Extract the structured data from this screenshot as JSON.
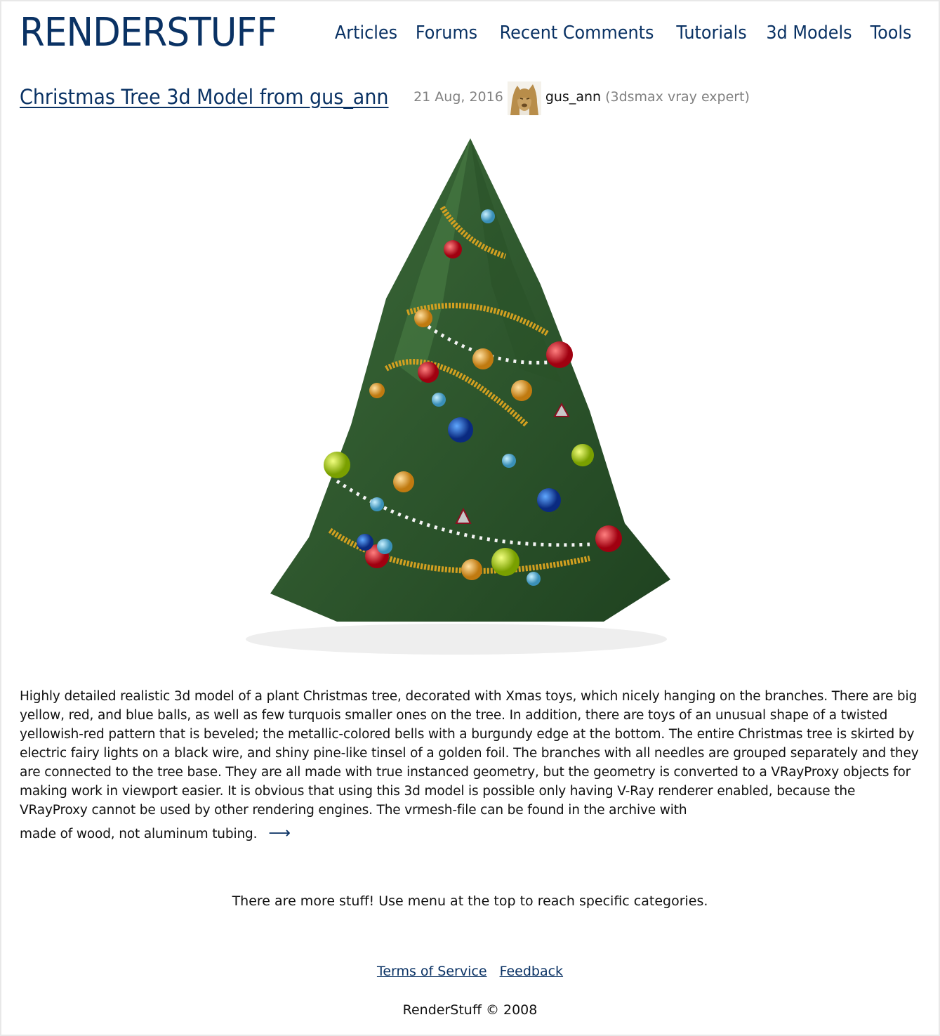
{
  "site": {
    "logo": "RENDERSTUFF",
    "nav": [
      "Articles",
      "Forums",
      "Recent Comments",
      "Tutorials",
      "3d Models",
      "Tools"
    ]
  },
  "post": {
    "title": "Christmas Tree 3d Model from gus_ann",
    "date": "21 Aug, 2016",
    "author": "gus_ann",
    "author_role": "(3dsmax vray expert)",
    "avatar_icon": "cougar-avatar",
    "image_alt": "Decorated Christmas tree 3d render",
    "description": "Highly detailed realistic 3d model of a plant Christmas tree, decorated with Xmas toys, which nicely hanging on the branches. There are big yellow, red, and blue balls, as well as few turquois smaller ones on the tree. In addition, there are toys of an unusual shape of a twisted yellowish-red pattern that is beveled; the metallic-colored bells with a burgundy edge at the bottom. The entire Christmas tree is skirted by electric fairy lights on a black wire, and shiny pine-like tinsel of a golden foil. The branches with all needles are grouped separately and they are connected to the tree base. They are all made with true instanced geometry, but the geometry is converted to a VRayProxy objects for making work in viewport easier. It is obvious that using this 3d model is possible only having V-Ray renderer enabled, because the VRayProxy cannot be used by other rendering engines. The vrmesh-file can be found in the archive with",
    "description_tail": "made of wood, not aluminum tubing.",
    "read_more": "⟶"
  },
  "more_text": "There are more stuff! Use menu at the top to reach specific categories.",
  "footer": {
    "links": [
      "Terms of Service",
      "Feedback"
    ],
    "copyright": "RenderStuff © 2008"
  },
  "colors": {
    "brand": "#0a3264",
    "muted": "#808080"
  }
}
